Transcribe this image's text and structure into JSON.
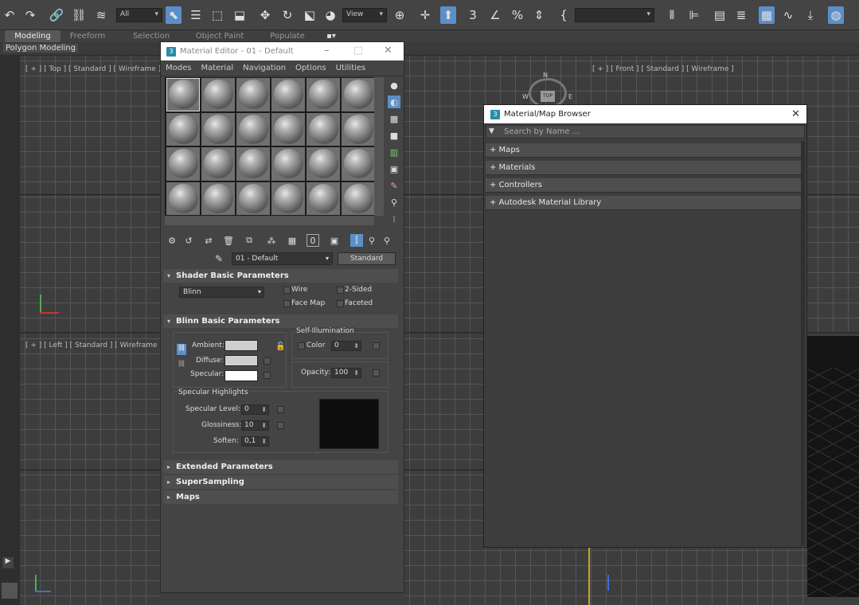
{
  "toolbar": {
    "selection_filter": "All",
    "ref_coord": "View",
    "named_selection": "",
    "icons": [
      "undo-icon",
      "redo-icon",
      "link-icon",
      "unlink-icon",
      "bind-spacewarp-icon",
      "select-object-icon",
      "select-by-name-icon",
      "rect-selection-icon",
      "window-crossing-icon",
      "move-icon",
      "rotate-icon",
      "scale-icon",
      "placement-icon",
      "use-pivot-icon",
      "select-manipulate-icon",
      "snap-3d-icon",
      "angle-snap-icon",
      "percent-snap-icon",
      "spinner-snap-icon",
      "edit-named-sets-icon",
      "mirror-icon",
      "align-icon",
      "scene-explorer-icon",
      "layer-explorer-icon",
      "ribbon-toggle-icon",
      "curve-editor-icon",
      "schematic-view-icon",
      "material-editor-icon"
    ]
  },
  "ribbon": {
    "tabs": [
      "Modeling",
      "Freeform",
      "Selection",
      "Object Paint",
      "Populate"
    ],
    "active_tab": "Modeling",
    "sub_label": "Polygon Modeling"
  },
  "viewports": {
    "top": "[ + ] [ Top ] [ Standard ] [ Wireframe ]",
    "front": "[ + ] [ Front ] [ Standard ] [ Wireframe ]",
    "left": "[ + ] [ Left ] [ Standard ] [ Wireframe ]"
  },
  "material_editor": {
    "title": "Material Editor - 01 - Default",
    "menu": [
      "Modes",
      "Material",
      "Navigation",
      "Options",
      "Utilities"
    ],
    "material_name": "01 - Default",
    "material_type": "Standard",
    "shader_panel": {
      "title": "Shader Basic Parameters",
      "shader": "Blinn",
      "options": [
        "Wire",
        "2-Sided",
        "Face Map",
        "Faceted"
      ]
    },
    "blinn_panel": {
      "title": "Blinn Basic Parameters",
      "ambient": "Ambient:",
      "diffuse": "Diffuse:",
      "specular": "Specular:",
      "self_illum_title": "Self-Illumination",
      "self_illum_color_label": "Color",
      "self_illum_color_value": "0",
      "opacity_label": "Opacity:",
      "opacity_value": "100",
      "spec_title": "Specular Highlights",
      "spec_level_label": "Specular Level:",
      "spec_level_value": "0",
      "gloss_label": "Glossiness:",
      "gloss_value": "10",
      "soften_label": "Soften:",
      "soften_value": "0,1"
    },
    "collapsed_panels": [
      "Extended Parameters",
      "SuperSampling",
      "Maps"
    ]
  },
  "map_browser": {
    "title": "Material/Map Browser",
    "search_placeholder": "Search by Name ...",
    "categories": [
      "+ Maps",
      "+ Materials",
      "+ Controllers",
      "+ Autodesk Material Library"
    ]
  },
  "viewcube": {
    "labels": [
      "N",
      "W",
      "TOP",
      "E"
    ]
  }
}
